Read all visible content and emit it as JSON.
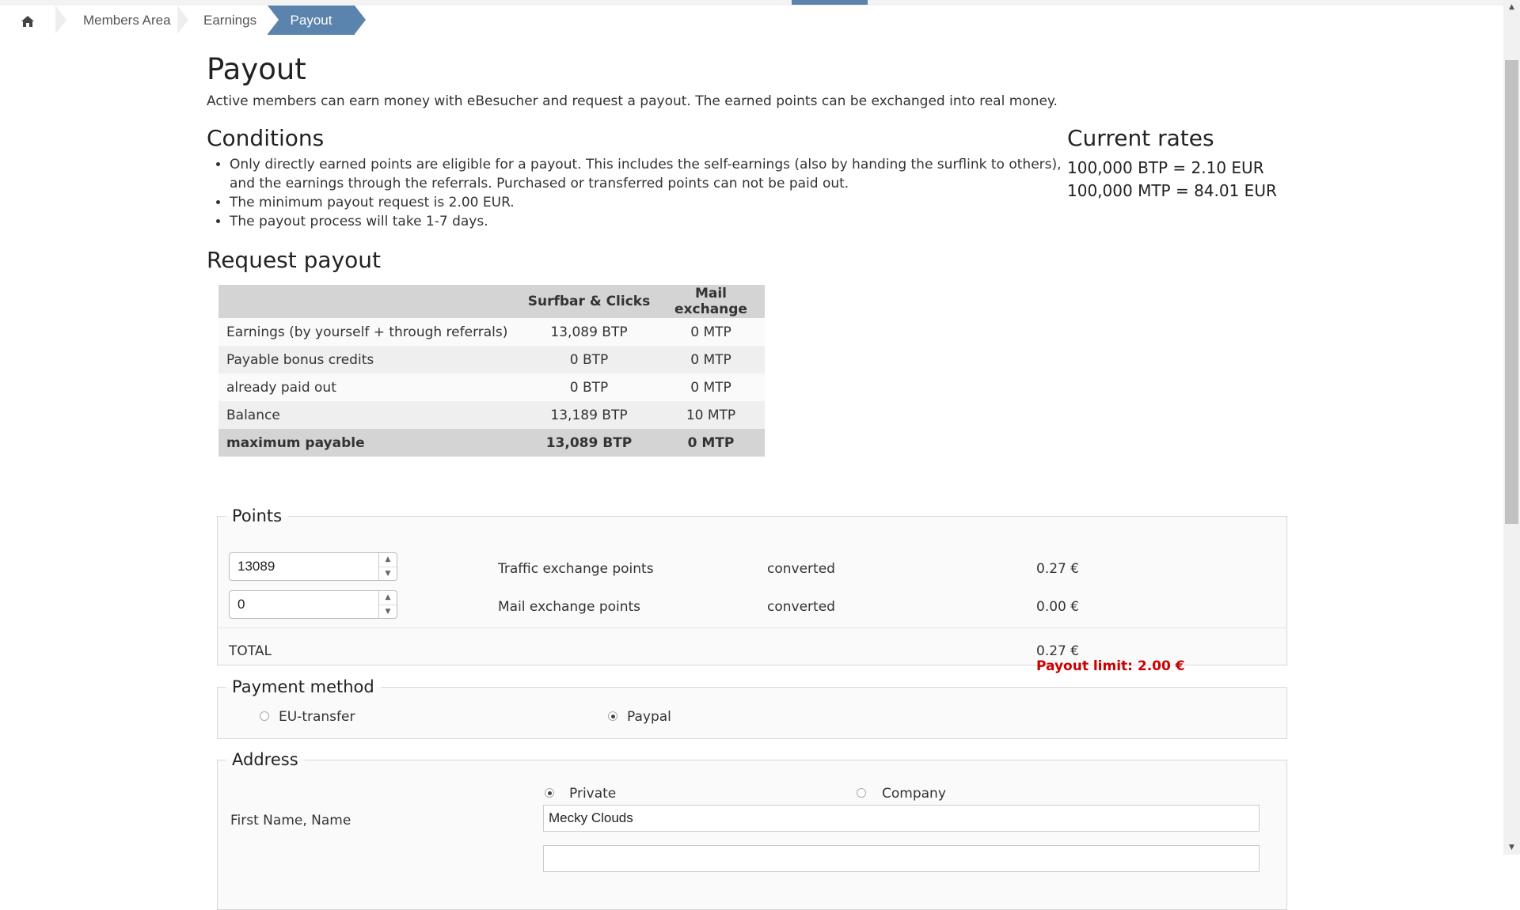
{
  "breadcrumb": {
    "home_icon": "home-icon",
    "items": [
      "Members Area",
      "Earnings",
      "Payout"
    ]
  },
  "page": {
    "title": "Payout",
    "intro": "Active members can earn money with eBesucher and request a payout. The earned points can be exchanged into real money."
  },
  "conditions": {
    "heading": "Conditions",
    "items": [
      "Only directly earned points are eligible for a payout. This includes the self-earnings (also by handing the surflink to others), and the earnings through the referrals. Purchased or transferred points can not be paid out.",
      "The minimum payout request is 2.00 EUR.",
      "The payout process will take 1-7 days."
    ]
  },
  "rates": {
    "heading": "Current rates",
    "btp": "100,000 BTP = 2.10 EUR",
    "mtp": "100,000 MTP = 84.01 EUR"
  },
  "request": {
    "heading": "Request payout",
    "columns": [
      "",
      "Surfbar & Clicks",
      "Mail exchange"
    ],
    "rows": [
      {
        "label": "Earnings (by yourself + through referrals)",
        "btp": "13,089 BTP",
        "mtp": "0 MTP"
      },
      {
        "label": "Payable bonus credits",
        "btp": "0 BTP",
        "mtp": "0 MTP"
      },
      {
        "label": "already paid out",
        "btp": "0 BTP",
        "mtp": "0 MTP"
      },
      {
        "label": "Balance",
        "btp": "13,189 BTP",
        "mtp": "10 MTP"
      },
      {
        "label": "maximum payable",
        "btp": "13,089 BTP",
        "mtp": "0 MTP"
      }
    ]
  },
  "points": {
    "legend": "Points",
    "traffic": {
      "value": "13089",
      "label": "Traffic exchange points",
      "status": "converted",
      "amount": "0.27 €"
    },
    "mail": {
      "value": "0",
      "label": "Mail exchange points",
      "status": "converted",
      "amount": "0.00 €"
    },
    "total_label": "TOTAL",
    "total_amount": "0.27 €",
    "limit": "Payout limit: 2.00 €",
    "limit_color": "#cc0000"
  },
  "payment": {
    "legend": "Payment method",
    "options": [
      "EU-transfer",
      "Paypal"
    ],
    "selected": "Paypal"
  },
  "address": {
    "legend": "Address",
    "options": [
      "Private",
      "Company"
    ],
    "selected": "Private",
    "name_label": "First Name, Name",
    "name_value": "Mecky Clouds"
  },
  "colors": {
    "accent": "#5a84ad",
    "table_header": "#d4d4d4"
  }
}
